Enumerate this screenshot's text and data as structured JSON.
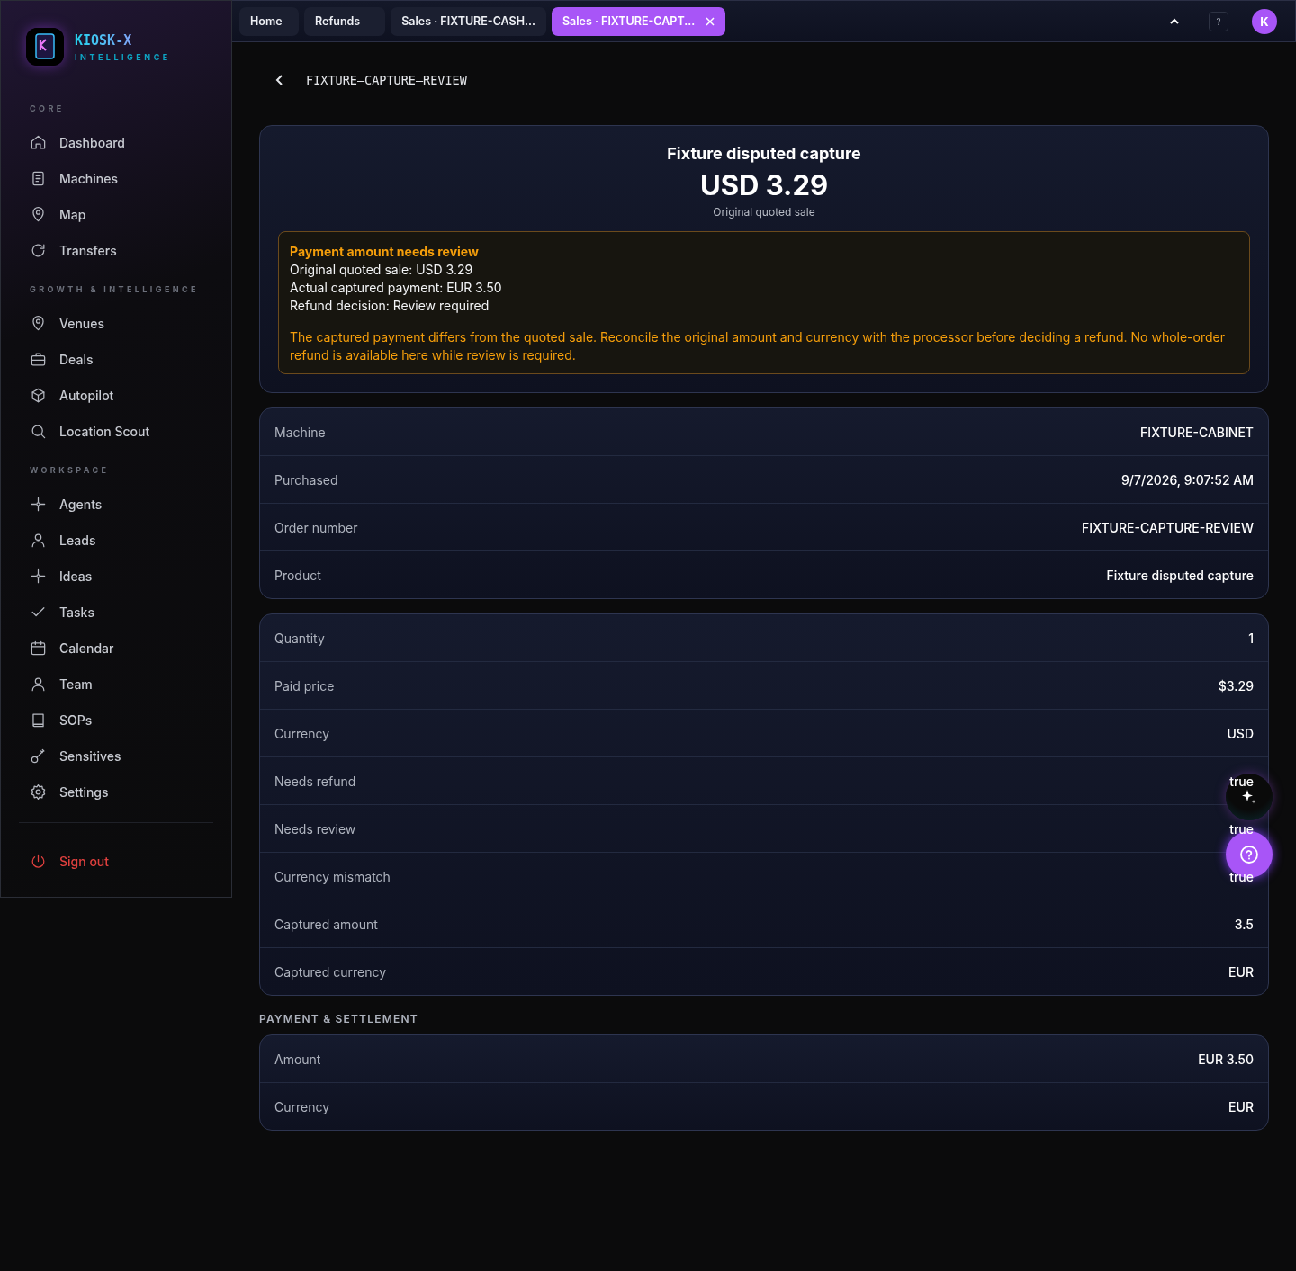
{
  "brand": {
    "name": "KIOSK-X",
    "tagline": "INTELLIGENCE"
  },
  "sidebar": {
    "sections": [
      {
        "title": "CORE",
        "items": [
          {
            "label": "Dashboard"
          },
          {
            "label": "Machines"
          },
          {
            "label": "Map"
          },
          {
            "label": "Transfers"
          }
        ]
      },
      {
        "title": "GROWTH & INTELLIGENCE",
        "items": [
          {
            "label": "Venues"
          },
          {
            "label": "Deals"
          },
          {
            "label": "Autopilot"
          },
          {
            "label": "Location Scout"
          }
        ]
      },
      {
        "title": "WORKSPACE",
        "items": [
          {
            "label": "Agents"
          },
          {
            "label": "Leads"
          },
          {
            "label": "Ideas"
          },
          {
            "label": "Tasks"
          },
          {
            "label": "Calendar"
          },
          {
            "label": "Team"
          },
          {
            "label": "SOPs"
          },
          {
            "label": "Sensitives"
          },
          {
            "label": "Settings"
          }
        ]
      }
    ],
    "sign_out": "Sign out"
  },
  "tabs": [
    {
      "label": "Home",
      "selected": false
    },
    {
      "label": "Refunds",
      "selected": false
    },
    {
      "label": "Sales · FIXTURE-CASH...",
      "selected": false
    },
    {
      "label": "Sales · FIXTURE-CAPT...",
      "selected": true
    }
  ],
  "topbar": {
    "help": "?",
    "avatar": "K"
  },
  "page_title": "FIXTURE–CAPTURE–REVIEW",
  "summary": {
    "title": "Fixture disputed capture",
    "amount": "USD 3.29",
    "caption": "Original quoted sale",
    "alert": {
      "title": "Payment amount needs review",
      "lines": [
        "Original quoted sale: USD 3.29",
        "Actual captured payment: EUR 3.50",
        "Refund decision: Review required"
      ],
      "message": "The captured payment differs from the quoted sale. Reconcile the original amount and currency with the processor before deciding a refund. No whole-order refund is available here while review is required."
    }
  },
  "details": [
    [
      {
        "label": "Machine",
        "value": "FIXTURE-CABINET"
      },
      {
        "label": "Purchased",
        "value": "9/7/2026, 9:07:52 AM"
      },
      {
        "label": "Order number",
        "value": "FIXTURE-CAPTURE-REVIEW"
      },
      {
        "label": "Product",
        "value": "Fixture disputed capture"
      }
    ],
    [
      {
        "label": "Quantity",
        "value": "1"
      },
      {
        "label": "Paid price",
        "value": "$3.29"
      },
      {
        "label": "Currency",
        "value": "USD"
      },
      {
        "label": "Needs refund",
        "value": "true"
      },
      {
        "label": "Needs review",
        "value": "true"
      },
      {
        "label": "Currency mismatch",
        "value": "true"
      },
      {
        "label": "Captured amount",
        "value": "3.5"
      },
      {
        "label": "Captured currency",
        "value": "EUR"
      }
    ]
  ],
  "payment": {
    "title": "PAYMENT & SETTLEMENT",
    "rows": [
      {
        "label": "Amount",
        "value": "EUR 3.50"
      },
      {
        "label": "Currency",
        "value": "EUR"
      }
    ]
  }
}
